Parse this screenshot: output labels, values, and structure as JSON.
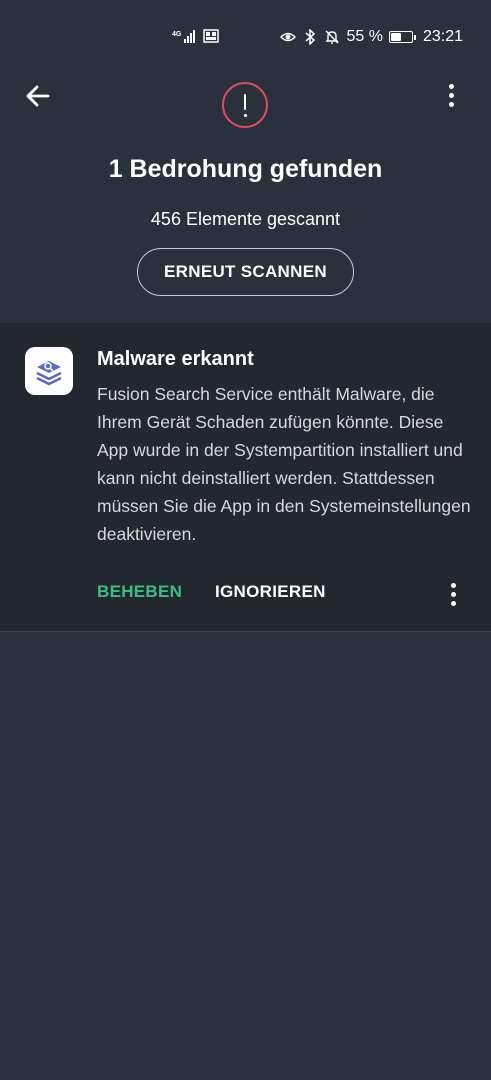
{
  "status_bar": {
    "network": "4G",
    "battery_percent": "55 %",
    "battery_level": 0.55,
    "time": "23:21",
    "icons": [
      "signal-icon",
      "eye-icon",
      "bluetooth-icon",
      "bell-off-icon",
      "battery-icon"
    ]
  },
  "header": {
    "title": "1 Bedrohung gefunden",
    "scanned": "456 Elemente gescannt",
    "rescan_label": "ERNEUT SCANNEN",
    "alert_color": "#e04b60"
  },
  "threat": {
    "title": "Malware erkannt",
    "description": "Fusion Search Service enthält Malware, die Ihrem Gerät Schaden zufügen könnte. Diese App wurde in der Systempartition installiert und kann nicht deinstalliert werden. Stattdessen müssen Sie die App in den Systemeinstellungen deaktivieren.",
    "fix_label": "BEHEBEN",
    "fix_color": "#3dbf83",
    "ignore_label": "IGNORIEREN"
  }
}
